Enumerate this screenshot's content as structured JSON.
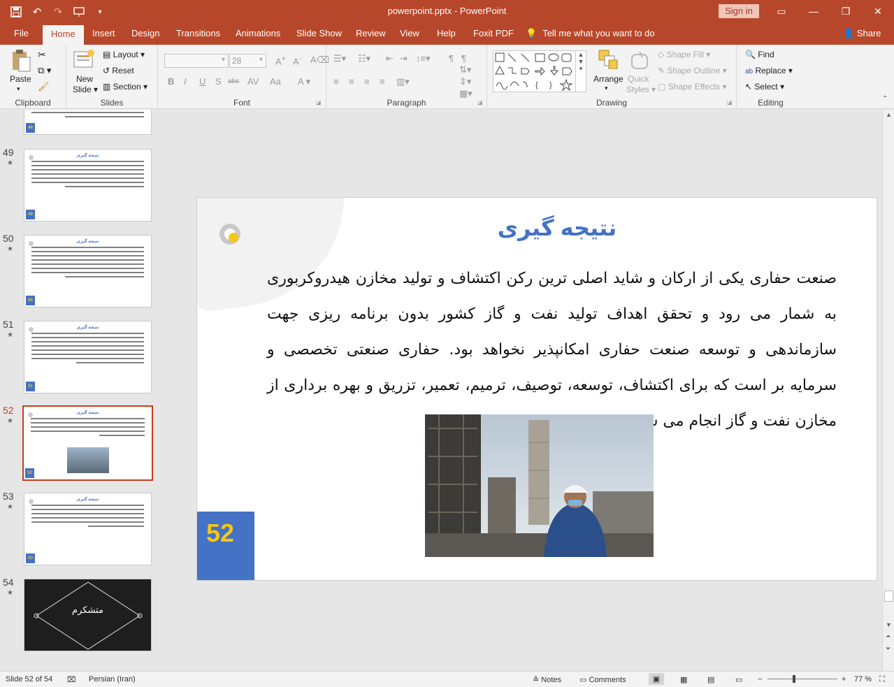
{
  "window": {
    "title": "powerpoint.pptx  -  PowerPoint",
    "signin_label": "Sign in",
    "minimize": "—",
    "maximize": "❐",
    "close": "✕"
  },
  "tabs": [
    "File",
    "Home",
    "Insert",
    "Design",
    "Transitions",
    "Animations",
    "Slide Show",
    "Review",
    "View",
    "Help",
    "Foxit PDF"
  ],
  "tell_me": "Tell me what you want to do",
  "share_label": "Share",
  "ribbon": {
    "clipboard": {
      "label": "Clipboard",
      "paste": "Paste"
    },
    "slides": {
      "label": "Slides",
      "new_slide_1": "New",
      "new_slide_2": "Slide",
      "layout": "Layout",
      "reset": "Reset",
      "section": "Section"
    },
    "font": {
      "label": "Font",
      "size": "28"
    },
    "paragraph": {
      "label": "Paragraph"
    },
    "drawing": {
      "label": "Drawing",
      "arrange": "Arrange",
      "quick_1": "Quick",
      "quick_2": "Styles",
      "shape_fill": "Shape Fill",
      "shape_outline": "Shape Outline",
      "shape_effects": "Shape Effects"
    },
    "editing": {
      "label": "Editing",
      "find": "Find",
      "replace": "Replace",
      "select": "Select"
    }
  },
  "thumbnails": [
    {
      "num": "48",
      "title": "",
      "show_num": false
    },
    {
      "num": "49",
      "title": "نتیجه گیری",
      "show_num": true
    },
    {
      "num": "50",
      "title": "نتیجه گیری",
      "show_num": true
    },
    {
      "num": "51",
      "title": "نتیجه گیری",
      "show_num": true
    },
    {
      "num": "52",
      "title": "نتیجه گیری",
      "show_num": true
    },
    {
      "num": "53",
      "title": "نتیجه گیری",
      "show_num": true
    },
    {
      "num": "54",
      "title": "متشکرم",
      "show_num": true
    }
  ],
  "slide": {
    "title": "نتیجه گیری",
    "body": "صنعت حفاری یکی از ارکان و شاید اصلی ترین رکن اکتشاف و تولید مخازن هیدروکربوری به شمار می رود و تحقق اهداف تولید نفت و گاز کشور بدون برنامه ریزی جهت سازماندهی و توسعه صنعت حفاری امکانپذیر نخواهد بود. حفاری صنعتی تخصصی و سرمایه بر است که برای اکتشاف، توسعه، توصیف، ترمیم، تعمیر، تزریق و بهره برداری از مخازن نفت و گاز انجام می شود.",
    "number": "52"
  },
  "status": {
    "slide_info": "Slide 52 of 54",
    "language": "Persian (Iran)",
    "notes": "Notes",
    "comments": "Comments",
    "zoom": "77 %"
  },
  "colors": {
    "accent": "#b7472a",
    "title_blue": "#4472c4",
    "number_yellow": "#f5c518"
  }
}
